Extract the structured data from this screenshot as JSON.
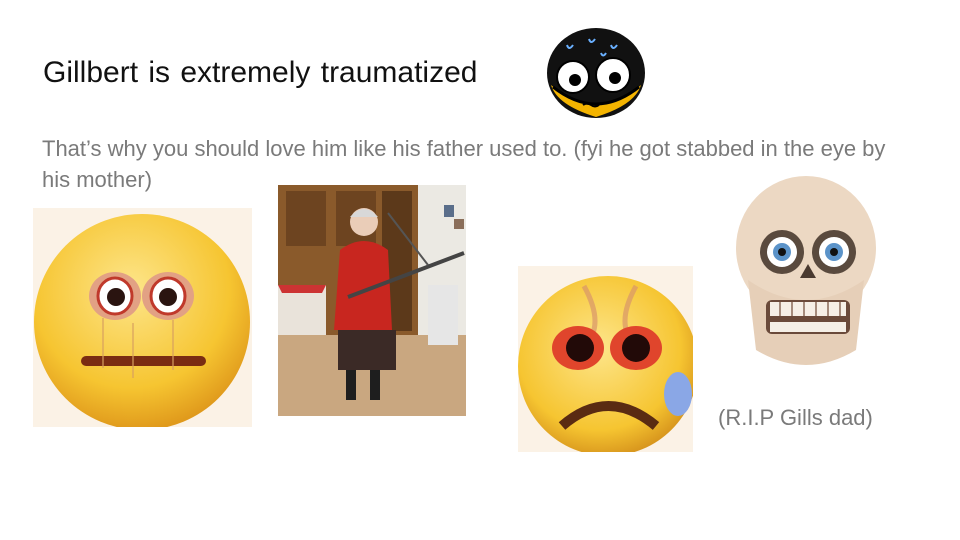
{
  "slide": {
    "title": "Gillbert is extremely traumatized",
    "body": "That’s why you should love him like his father used to. (fyi he got stabbed in the eye by his mother)",
    "caption": "(R.I.P Gills dad)"
  },
  "colors": {
    "emoji_yellow": "#f6c531",
    "body_text": "#7a7a7a",
    "title_text": "#111111"
  },
  "images": [
    {
      "icon": "black-yellow-round-face-icon"
    },
    {
      "icon": "cursed-emoji-bulging-eyes-icon"
    },
    {
      "icon": "old-woman-with-sword-photo"
    },
    {
      "icon": "crying-cursed-emoji-icon"
    },
    {
      "icon": "skull-with-eyes-icon"
    }
  ]
}
